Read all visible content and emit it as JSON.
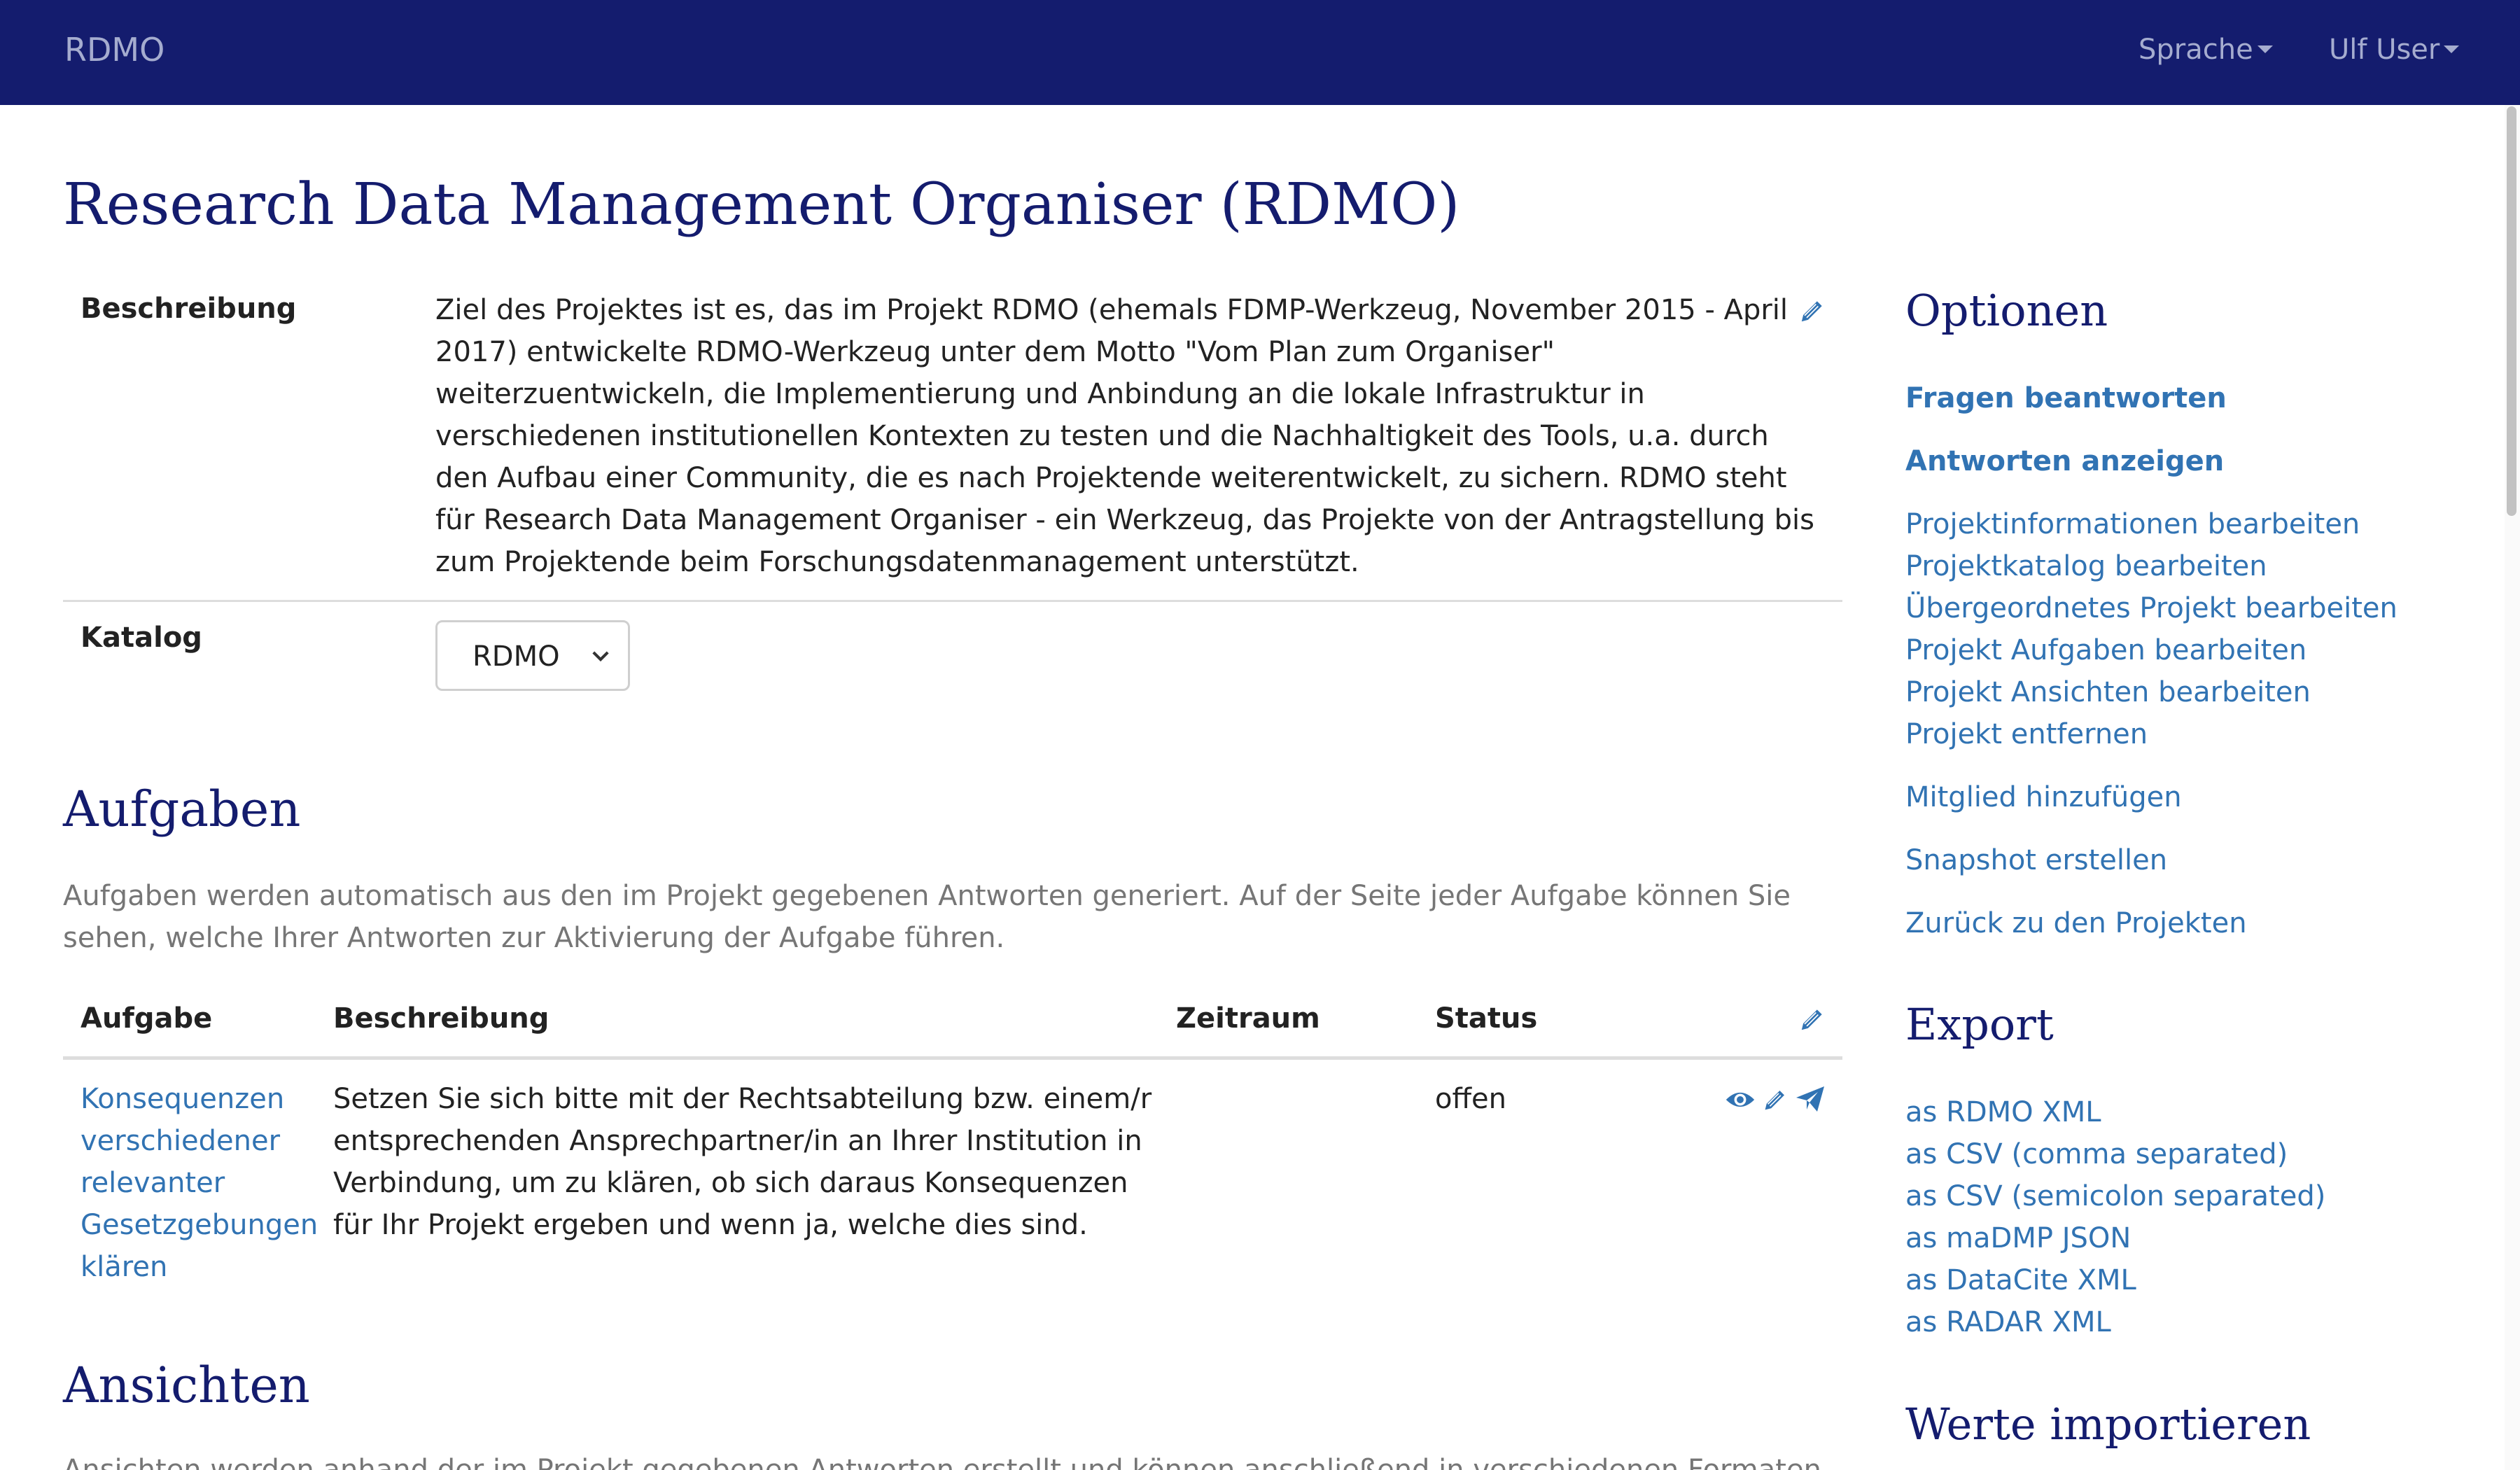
{
  "navbar": {
    "brand": "RDMO",
    "language_menu": "Sprache",
    "user_menu": "Ulf User"
  },
  "page": {
    "title": "Research Data Management Organiser (RDMO)"
  },
  "project": {
    "description_label": "Beschreibung",
    "description_text": "Ziel des Projektes ist es, das im Projekt RDMO (ehemals FDMP-Werkzeug, November 2015 - April 2017) entwickelte RDMO-Werkzeug unter dem Motto \"Vom Plan zum Organiser\" weiterzuentwickeln, die Implementierung und Anbindung an die lokale Infrastruktur in verschiedenen institutionellen Kontexten zu testen und die Nachhaltigkeit des Tools, u.a. durch den Aufbau einer Community, die es nach Projektende weiterentwickelt, zu sichern. RDMO steht für Research Data Management Organiser - ein Werkzeug, das Projekte von der Antragstellung bis zum Projektende beim Forschungsdatenmanagement unterstützt.",
    "catalog_label": "Katalog",
    "catalog_value": "RDMO"
  },
  "tasks": {
    "heading": "Aufgaben",
    "intro": "Aufgaben werden automatisch aus den im Projekt gegebenen Antworten generiert. Auf der Seite jeder Aufgabe können Sie sehen, welche Ihrer Antworten zur Aktivierung der Aufgabe führen.",
    "columns": [
      "Aufgabe",
      "Beschreibung",
      "Zeitraum",
      "Status"
    ],
    "rows": [
      {
        "task": "Konsequenzen verschiedener relevanter Gesetzgebungen klären",
        "description": "Setzen Sie sich bitte mit der Rechtsabteilung bzw. einem/r entsprechenden Ansprechpartner/in an Ihrer Institution in Verbindung, um zu klären, ob sich daraus Konsequenzen für Ihr Projekt ergeben und wenn ja, welche dies sind.",
        "period": "",
        "status": "offen"
      }
    ]
  },
  "views": {
    "heading": "Ansichten",
    "intro": "Ansichten werden anhand der im Projekt gegebenen Antworten erstellt und können anschließend in verschiedenen Formaten"
  },
  "sidebar": {
    "options_heading": "Optionen",
    "options": [
      "Fragen beantworten",
      "Antworten anzeigen",
      "Projektinformationen bearbeiten",
      "Projektkatalog bearbeiten",
      "Übergeordnetes Projekt bearbeiten",
      "Projekt Aufgaben bearbeiten",
      "Projekt Ansichten bearbeiten",
      "Projekt entfernen",
      "Mitglied hinzufügen",
      "Snapshot erstellen",
      "Zurück zu den Projekten"
    ],
    "export_heading": "Export",
    "exports": [
      "as RDMO XML",
      "as CSV (comma separated)",
      "as CSV (semicolon separated)",
      "as maDMP JSON",
      "as DataCite XML",
      "as RADAR XML"
    ],
    "import_heading": "Werte importieren"
  },
  "colors": {
    "navbar": "#141c6e",
    "navbar_text": "#a5accf",
    "heading": "#141c6e",
    "link": "#3173b3",
    "muted": "#767676"
  },
  "icons": [
    "pencil-icon",
    "eye-icon",
    "send-icon",
    "chevron-down-icon",
    "caret-down-icon"
  ]
}
